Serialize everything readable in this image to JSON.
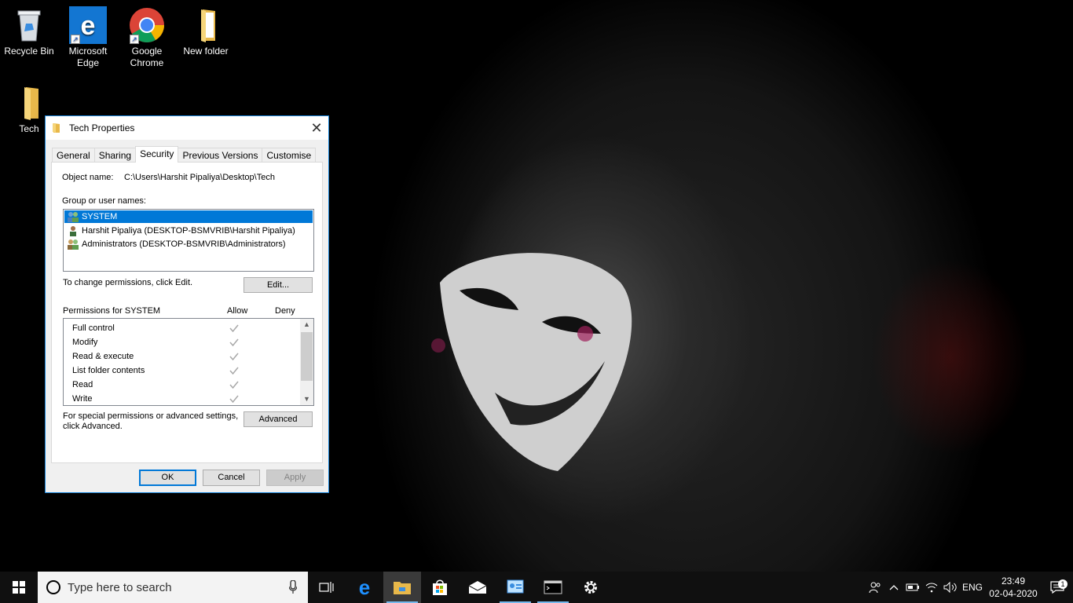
{
  "desktop": {
    "icons": [
      {
        "label": "Recycle Bin"
      },
      {
        "label": "Microsoft Edge"
      },
      {
        "label": "Google Chrome"
      },
      {
        "label": "New folder"
      },
      {
        "label": "Tech"
      }
    ]
  },
  "dialog": {
    "title": "Tech Properties",
    "tabs": [
      "General",
      "Sharing",
      "Security",
      "Previous Versions",
      "Customise"
    ],
    "active_tab": "Security",
    "object_name_label": "Object name:",
    "object_name_value": "C:\\Users\\Harshit Pipaliya\\Desktop\\Tech",
    "group_label": "Group or user names:",
    "users": [
      "SYSTEM",
      "Harshit Pipaliya (DESKTOP-BSMVRIB\\Harshit Pipaliya)",
      "Administrators (DESKTOP-BSMVRIB\\Administrators)"
    ],
    "change_text": "To change permissions, click Edit.",
    "edit_button": "Edit...",
    "permissions_label": "Permissions for SYSTEM",
    "allow_header": "Allow",
    "deny_header": "Deny",
    "permissions": [
      {
        "name": "Full control",
        "allow": true,
        "deny": false
      },
      {
        "name": "Modify",
        "allow": true,
        "deny": false
      },
      {
        "name": "Read & execute",
        "allow": true,
        "deny": false
      },
      {
        "name": "List folder contents",
        "allow": true,
        "deny": false
      },
      {
        "name": "Read",
        "allow": true,
        "deny": false
      },
      {
        "name": "Write",
        "allow": true,
        "deny": false
      }
    ],
    "advanced_text_1": "For special permissions or advanced settings,",
    "advanced_text_2": "click Advanced.",
    "advanced_button": "Advanced",
    "ok_button": "OK",
    "cancel_button": "Cancel",
    "apply_button": "Apply"
  },
  "taskbar": {
    "search_placeholder": "Type here to search",
    "language": "ENG",
    "time": "23:49",
    "date": "02-04-2020",
    "notification_count": "1"
  }
}
